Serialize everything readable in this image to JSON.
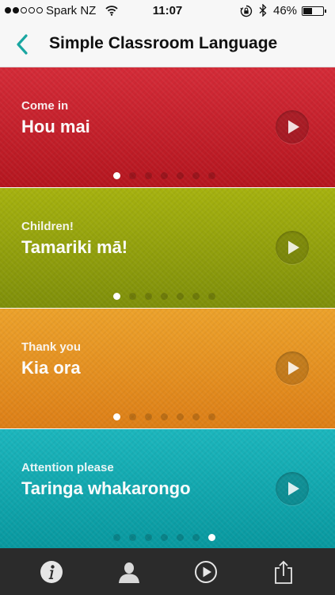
{
  "status_bar": {
    "carrier": "Spark NZ",
    "time": "11:07",
    "battery": "46%",
    "battery_level": 0.46
  },
  "header": {
    "title": "Simple Classroom Language",
    "accent_color": "#1aa6a1"
  },
  "cards": [
    {
      "english": "Come in",
      "maori": "Hou mai",
      "color_top": "#d42b38",
      "color_bottom": "#b5161f",
      "active_dot": 0,
      "dot_count": 7
    },
    {
      "english": "Children!",
      "maori": "Tamariki mā!",
      "color_top": "#a6b20f",
      "color_bottom": "#7f8f0a",
      "active_dot": 0,
      "dot_count": 7
    },
    {
      "english": "Thank you",
      "maori": "Kia ora",
      "color_top": "#eca22b",
      "color_bottom": "#dd7f17",
      "active_dot": 0,
      "dot_count": 7
    },
    {
      "english": "Attention please",
      "maori": "Taringa whakarongo",
      "color_top": "#1cb6bd",
      "color_bottom": "#08989f",
      "active_dot": 6,
      "dot_count": 7
    }
  ],
  "tab_bar": {
    "items": [
      {
        "name": "info-icon"
      },
      {
        "name": "person-icon"
      },
      {
        "name": "play-icon"
      },
      {
        "name": "share-icon"
      }
    ]
  }
}
